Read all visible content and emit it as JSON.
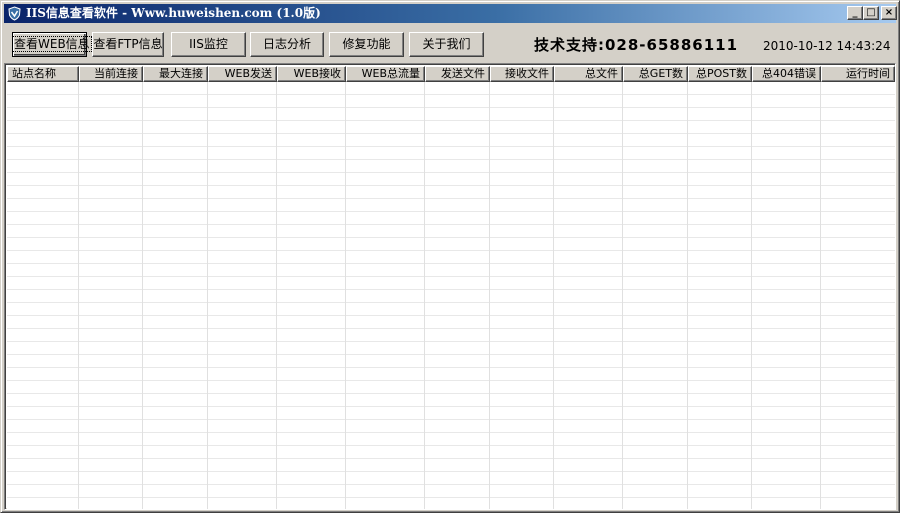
{
  "window": {
    "title": "IIS信息查看软件 - Www.huweishen.com (1.0版)",
    "caption_buttons": {
      "minimize": "_",
      "maximize": "□",
      "close": "×"
    }
  },
  "toolbar": {
    "buttons": [
      {
        "label": "查看WEB信息",
        "active": true
      },
      {
        "label": "查看FTP信息"
      },
      {
        "label": "IIS监控"
      },
      {
        "label": "日志分析"
      },
      {
        "label": "修复功能"
      },
      {
        "label": "关于我们"
      }
    ],
    "support_text": "技术支持:028-65886111",
    "datetime": "2010-10-12 14:43:24"
  },
  "table": {
    "columns": [
      {
        "label": "站点名称",
        "align": "left"
      },
      {
        "label": "当前连接",
        "align": "right"
      },
      {
        "label": "最大连接",
        "align": "right"
      },
      {
        "label": "WEB发送",
        "align": "right"
      },
      {
        "label": "WEB接收",
        "align": "right"
      },
      {
        "label": "WEB总流量",
        "align": "right"
      },
      {
        "label": "发送文件",
        "align": "right"
      },
      {
        "label": "接收文件",
        "align": "right"
      },
      {
        "label": "总文件",
        "align": "right"
      },
      {
        "label": "总GET数",
        "align": "right"
      },
      {
        "label": "总POST数",
        "align": "right"
      },
      {
        "label": "总404错误",
        "align": "right"
      },
      {
        "label": "运行时间",
        "align": "right"
      }
    ],
    "rows": []
  },
  "colors": {
    "titlebar_start": "#0a246a",
    "titlebar_end": "#a6caf0",
    "face": "#d4d0c8"
  }
}
